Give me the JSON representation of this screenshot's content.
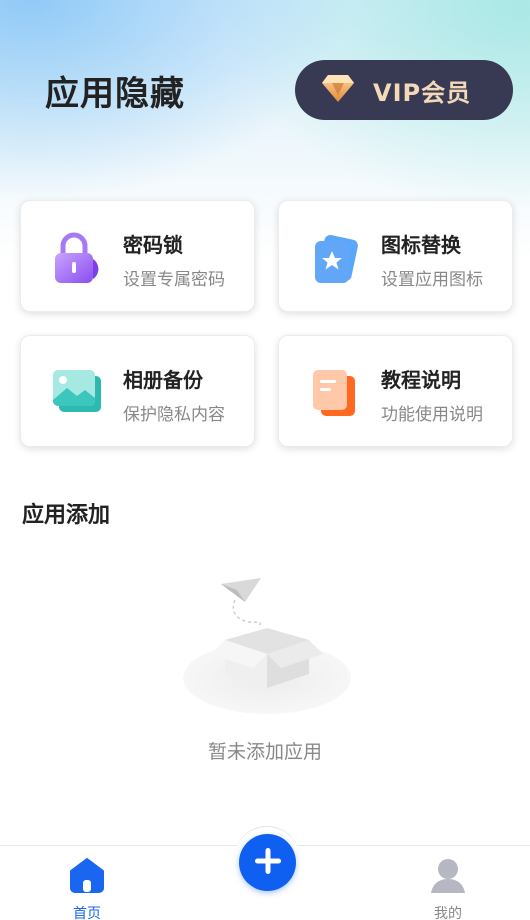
{
  "header": {
    "title": "应用隐藏",
    "vip_label": "VIP会员",
    "vip_icon": "diamond-icon"
  },
  "cards": [
    {
      "title": "密码锁",
      "subtitle": "设置专属密码",
      "icon": "lock-icon"
    },
    {
      "title": "图标替换",
      "subtitle": "设置应用图标",
      "icon": "star-card-icon"
    },
    {
      "title": "相册备份",
      "subtitle": "保护隐私内容",
      "icon": "photo-icon"
    },
    {
      "title": "教程说明",
      "subtitle": "功能使用说明",
      "icon": "document-icon"
    }
  ],
  "section": {
    "title": "应用添加",
    "empty_text": "暂未添加应用"
  },
  "tabbar": {
    "home_label": "首页",
    "add_icon": "plus-icon",
    "mine_label": "我的"
  },
  "colors": {
    "accent": "#0f5ff0",
    "vip_bg": "#373a52",
    "vip_text": "#f3d9b8"
  }
}
